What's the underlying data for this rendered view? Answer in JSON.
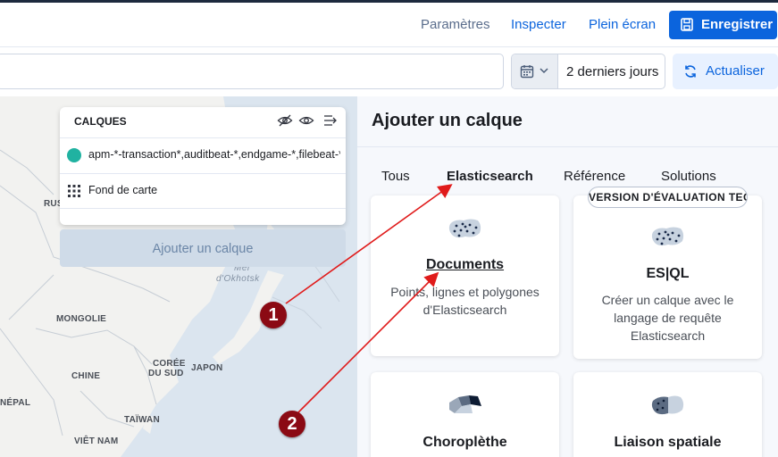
{
  "header": {
    "links": [
      {
        "label": "Paramètres"
      },
      {
        "label": "Inspecter"
      },
      {
        "label": "Plein écran"
      }
    ],
    "save_label": "Enregistrer"
  },
  "querybar": {
    "search_value": "",
    "date_range": "2 derniers jours",
    "refresh_label": "Actualiser"
  },
  "map": {
    "labels": {
      "russia": "RUS",
      "mongolia": "MONGOLIE",
      "china": "CHINE",
      "south_korea_1": "CORÉE",
      "south_korea_2": "DU SUD",
      "japan": "JAPON",
      "nepal": "NÉPAL",
      "taiwan": "TAÏWAN",
      "vietnam": "VIÊT NAM",
      "okhotsk_1": "Mer",
      "okhotsk_2": "d'Okhotsk"
    },
    "layers_panel": {
      "title": "CALQUES",
      "layers": [
        {
          "name": "apm-*-transaction*,auditbeat-*,endgame-*,filebeat-*,logs-*,packetbeat-*",
          "color": "#20b2a1"
        },
        {
          "name": "Fond de carte"
        }
      ]
    },
    "add_layer_label": "Ajouter un calque"
  },
  "panel": {
    "title": "Ajouter un calque",
    "tabs": [
      {
        "label": "Tous",
        "active": false
      },
      {
        "label": "Elasticsearch",
        "active": true
      },
      {
        "label": "Référence",
        "active": false
      },
      {
        "label": "Solutions",
        "active": false
      }
    ],
    "cards": [
      {
        "title": "Documents",
        "desc_line1": "Points, lignes et polygones",
        "desc_line2": "d'Elasticsearch",
        "icon": "documents-icon"
      },
      {
        "title": "ES|QL",
        "badge": "VERSION D'ÉVALUATION TECHNIQUE",
        "desc_line1": "Créer un calque avec le",
        "desc_line2": "langage de requête",
        "desc_line3": "Elasticsearch",
        "icon": "esql-icon"
      },
      {
        "title": "Choroplèthe",
        "icon": "choropleth-icon"
      },
      {
        "title": "Liaison spatiale",
        "icon": "spatial-join-icon"
      }
    ]
  },
  "annotations": [
    {
      "number": "1"
    },
    {
      "number": "2"
    }
  ],
  "colors": {
    "primary": "#0b64dd",
    "annotation": "#8b0a14",
    "arrow": "#e01b1b",
    "layer_dot": "#20b2a1"
  }
}
